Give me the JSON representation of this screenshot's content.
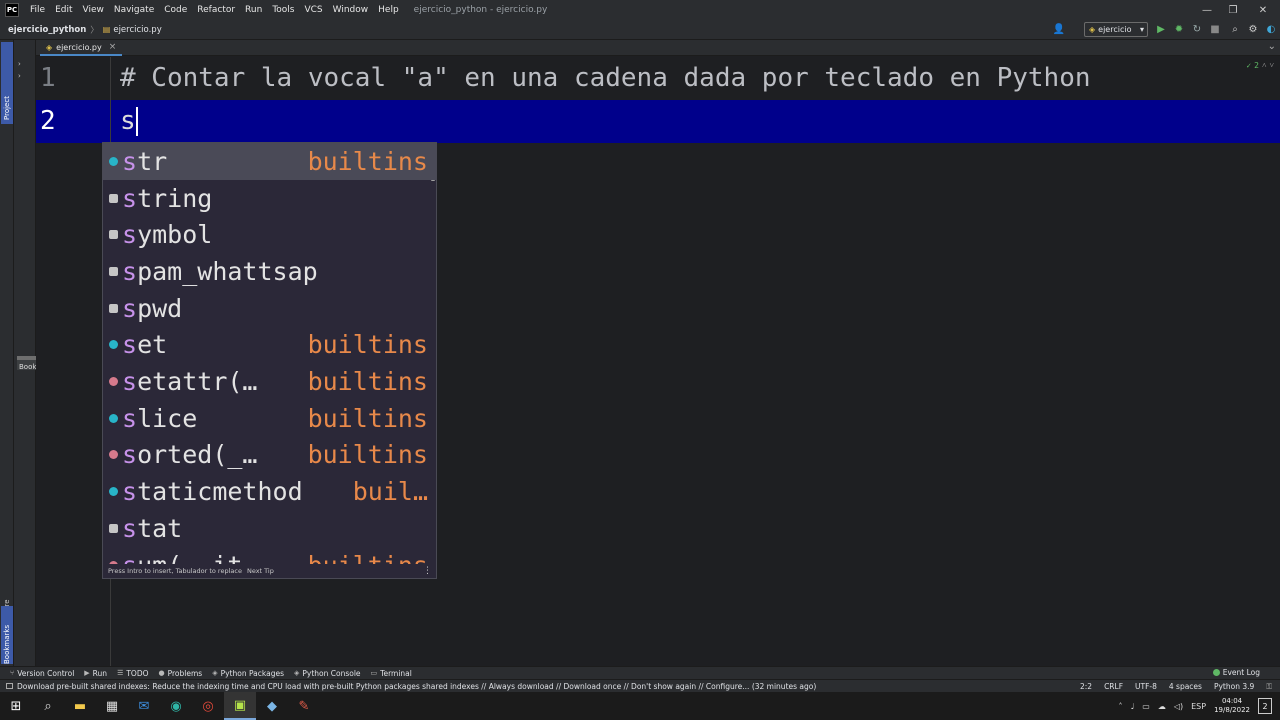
{
  "menubar": {
    "logo": "PC",
    "items": [
      "File",
      "Edit",
      "View",
      "Navigate",
      "Code",
      "Refactor",
      "Run",
      "Tools",
      "VCS",
      "Window",
      "Help"
    ],
    "title": "ejercicio_python - ejercicio.py"
  },
  "navbar": {
    "project": "ejercicio_python",
    "file": "ejercicio.py",
    "run_config": "ejercicio"
  },
  "sidebar": {
    "project_tab": "Project",
    "structure_tab": "Structure",
    "bookmarks_tab": "Bookmarks",
    "bookmarks_popup": "Book"
  },
  "tabs": [
    {
      "label": "ejercicio.py"
    }
  ],
  "editor": {
    "lines": [
      {
        "number": "1",
        "code": "# Contar la vocal \"a\" en una cadena dada por teclado en Python"
      },
      {
        "number": "2",
        "code": "s"
      }
    ],
    "inspection_count": "2"
  },
  "completion": {
    "items": [
      {
        "prefix": "s",
        "rest": "tr",
        "type": "builtins",
        "kind": "cls",
        "selected": true
      },
      {
        "prefix": "s",
        "rest": "tring",
        "type": "",
        "kind": "mod"
      },
      {
        "prefix": "s",
        "rest": "ymbol",
        "type": "",
        "kind": "mod"
      },
      {
        "prefix": "s",
        "rest": "pam_whattsap",
        "type": "",
        "kind": "mod"
      },
      {
        "prefix": "s",
        "rest": "pwd",
        "type": "",
        "kind": "mod"
      },
      {
        "prefix": "s",
        "rest": "et",
        "type": "builtins",
        "kind": "cls"
      },
      {
        "prefix": "s",
        "rest": "etattr(…",
        "type": "builtins",
        "kind": "fn"
      },
      {
        "prefix": "s",
        "rest": "lice",
        "type": "builtins",
        "kind": "cls"
      },
      {
        "prefix": "s",
        "rest": "orted(_…",
        "type": "builtins",
        "kind": "fn"
      },
      {
        "prefix": "s",
        "rest": "taticmethod",
        "type": "buil…",
        "kind": "cls"
      },
      {
        "prefix": "s",
        "rest": "tat",
        "type": "",
        "kind": "mod"
      },
      {
        "prefix": "s",
        "rest": "um(__it…",
        "type": "builtins",
        "kind": "fn"
      }
    ],
    "footer_hint": "Press Intro to insert, Tabulador to replace",
    "footer_link": "Next Tip"
  },
  "toolwindows": {
    "buttons": [
      "Version Control",
      "Run",
      "TODO",
      "Problems",
      "Python Packages",
      "Python Console",
      "Terminal"
    ],
    "event_log": "Event Log"
  },
  "statusbar": {
    "message": "Download pre-built shared indexes: Reduce the indexing time and CPU load with pre-built Python packages shared indexes // Always download // Download once // Don't show again // Configure... (32 minutes ago)",
    "position": "2:2",
    "line_sep": "CRLF",
    "encoding": "UTF-8",
    "indent": "4 spaces",
    "interpreter": "Python 3.9"
  },
  "taskbar": {
    "lang": "ESP",
    "time": "04:04",
    "date": "19/8/2022",
    "notifications": "2"
  }
}
